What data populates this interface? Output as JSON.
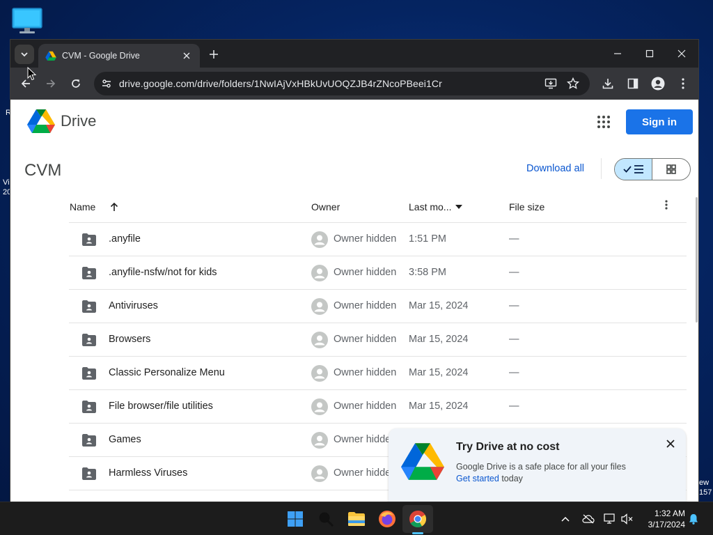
{
  "desktop": {
    "edge_texts": [
      "R",
      "Vi",
      "20",
      "ew",
      "157"
    ]
  },
  "browser": {
    "tab": {
      "title": "CVM - Google Drive"
    },
    "omnibox": {
      "url": "drive.google.com/drive/folders/1NwIAjVxHBkUvUOQZJB4rZNcoPBeei1Cr"
    }
  },
  "drive": {
    "brand": "Drive",
    "sign_in_label": "Sign in",
    "folder_title": "CVM",
    "download_all_label": "Download all",
    "columns": {
      "name": "Name",
      "owner": "Owner",
      "last_modified": "Last mo...",
      "file_size": "File size"
    },
    "rows": [
      {
        "name": ".anyfile",
        "owner": "Owner hidden",
        "modified": "1:51 PM",
        "size": "—"
      },
      {
        "name": ".anyfile-nsfw/not for kids",
        "owner": "Owner hidden",
        "modified": "3:58 PM",
        "size": "—"
      },
      {
        "name": "Antiviruses",
        "owner": "Owner hidden",
        "modified": "Mar 15, 2024",
        "size": "—"
      },
      {
        "name": "Browsers",
        "owner": "Owner hidden",
        "modified": "Mar 15, 2024",
        "size": "—"
      },
      {
        "name": "Classic Personalize Menu",
        "owner": "Owner hidden",
        "modified": "Mar 15, 2024",
        "size": "—"
      },
      {
        "name": "File browser/file utilities",
        "owner": "Owner hidden",
        "modified": "Mar 15, 2024",
        "size": "—"
      },
      {
        "name": "Games",
        "owner": "Owner hidde",
        "modified": "",
        "size": ""
      },
      {
        "name": "Harmless Viruses",
        "owner": "Owner hidde",
        "modified": "",
        "size": ""
      }
    ],
    "promo": {
      "title": "Try Drive at no cost",
      "body": "Google Drive is a safe place for all your files",
      "link": "Get started",
      "suffix": " today"
    }
  },
  "taskbar": {
    "time": "1:32 AM",
    "date": "3/17/2024"
  },
  "colors": {
    "accent": "#1a73e8",
    "link": "#0b57d0",
    "selected_view": "#c2e7ff"
  }
}
